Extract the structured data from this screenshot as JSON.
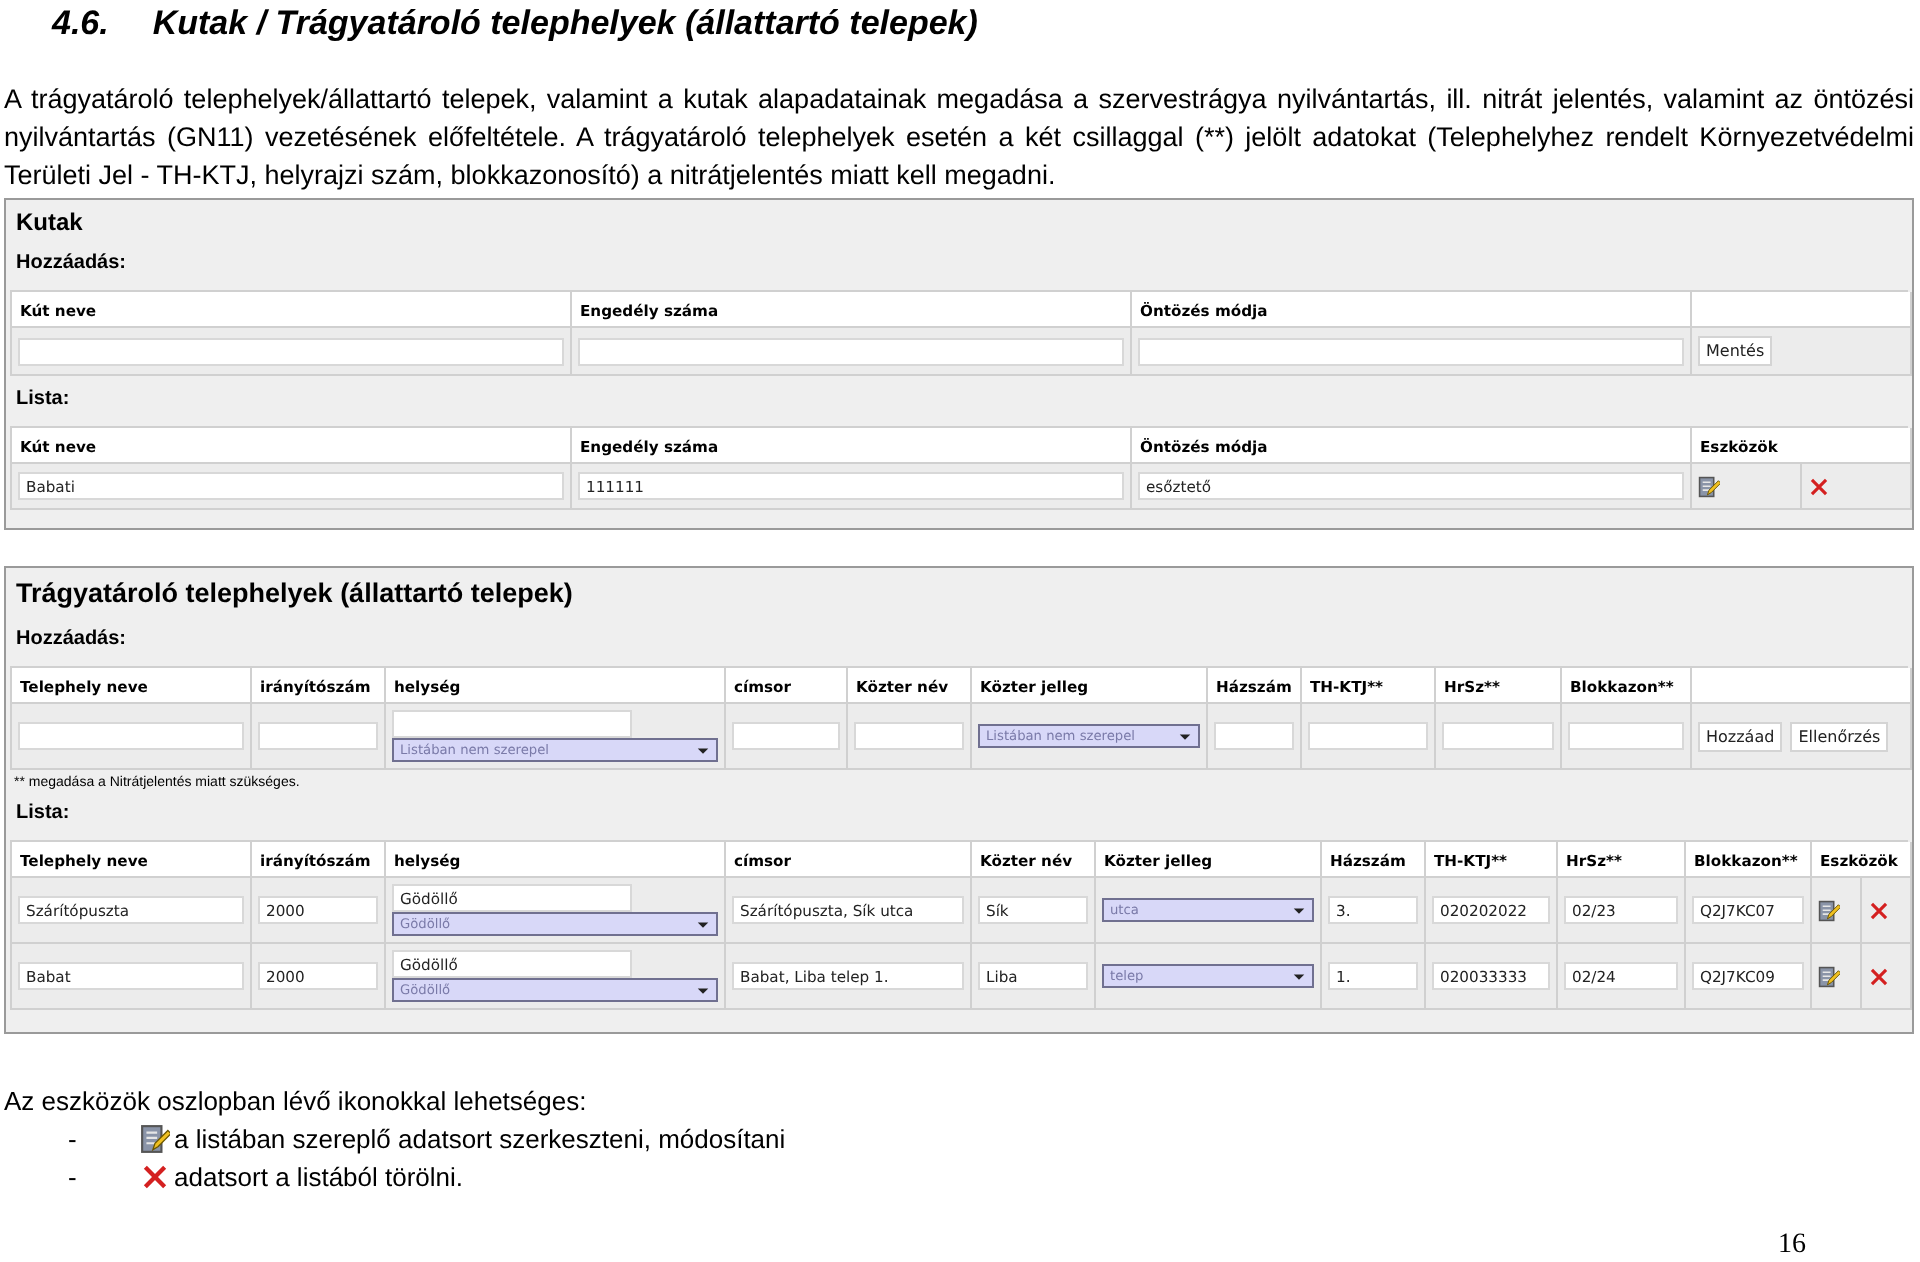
{
  "heading": {
    "number": "4.6.",
    "title": "Kutak / Trágyatároló telephelyek (állattartó telepek)"
  },
  "intro": "A trágyatároló telephelyek/állattartó telepek, valamint a kutak alapadatainak megadása a szervestrágya nyilvántartás, ill. nitrát jelentés, valamint az öntözési nyilvántartás (GN11) vezetésének előfeltétele. A trágyatároló telephelyek esetén a két csillaggal (**) jelölt adatokat (Telephelyhez rendelt Környezetvédelmi Területi Jel - TH-KTJ, helyrajzi szám, blokkazonosító) a nitrátjelentés miatt kell megadni.",
  "panels": [
    {
      "title": "Kutak",
      "add": {
        "title": "Hozzáadás:",
        "columns": [
          "Kút neve",
          "Engedély száma",
          "Öntözés módja"
        ],
        "fields": [
          {
            "kind": "input"
          },
          {
            "kind": "input"
          },
          {
            "kind": "input"
          }
        ],
        "buttons": [
          "Mentés"
        ]
      },
      "list": {
        "title": "Lista:",
        "columns": [
          "Kút neve",
          "Engedély száma",
          "Öntözés módja",
          "Eszközök"
        ],
        "rows": [
          {
            "cells": [
              {
                "kind": "input",
                "value": "Babati"
              },
              {
                "kind": "input",
                "value": "111111"
              },
              {
                "kind": "input",
                "value": "esőztető"
              }
            ]
          }
        ]
      }
    },
    {
      "title": "Trágyatároló telephelyek (állattartó telepek)",
      "add": {
        "title": "Hozzáadás:",
        "columns": [
          "Telephely neve",
          "irányítószám",
          "helység",
          "címsor",
          "Közter név",
          "Közter jelleg",
          "Házszám",
          "TH-KTJ**",
          "HrSz**",
          "Blokkazon**"
        ],
        "fields": [
          {
            "kind": "input"
          },
          {
            "kind": "input"
          },
          {
            "kind": "combo",
            "option": "Listában nem szerepel"
          },
          {
            "kind": "input"
          },
          {
            "kind": "input"
          },
          {
            "kind": "select",
            "option": "Listában nem szerepel"
          },
          {
            "kind": "input"
          },
          {
            "kind": "input"
          },
          {
            "kind": "input"
          },
          {
            "kind": "input"
          }
        ],
        "buttons": [
          "Hozzáad",
          "Ellenőrzés"
        ],
        "note": "** megadása a Nitrátjelentés miatt szükséges."
      },
      "list": {
        "title": "Lista:",
        "columns": [
          "Telephely neve",
          "irányítószám",
          "helység",
          "címsor",
          "Közter név",
          "Közter jelleg",
          "Házszám",
          "TH-KTJ**",
          "HrSz**",
          "Blokkazon**",
          "Eszközök"
        ],
        "rows": [
          {
            "cells": [
              {
                "kind": "input",
                "value": "Szárítópuszta"
              },
              {
                "kind": "input",
                "value": "2000"
              },
              {
                "kind": "combo",
                "value": "Gödöllő",
                "option": "Gödöllő"
              },
              {
                "kind": "input",
                "value": "Szárítópuszta, Sík utca"
              },
              {
                "kind": "input",
                "value": "Sík"
              },
              {
                "kind": "select",
                "option": "utca"
              },
              {
                "kind": "input",
                "value": "3."
              },
              {
                "kind": "input",
                "value": "020202022"
              },
              {
                "kind": "input",
                "value": "02/23"
              },
              {
                "kind": "input",
                "value": "Q2J7KC07"
              }
            ]
          },
          {
            "cells": [
              {
                "kind": "input",
                "value": "Babat"
              },
              {
                "kind": "input",
                "value": "2000"
              },
              {
                "kind": "combo",
                "value": "Gödöllő",
                "option": "Gödöllő"
              },
              {
                "kind": "input",
                "value": "Babat, Liba telep 1."
              },
              {
                "kind": "input",
                "value": "Liba"
              },
              {
                "kind": "select",
                "option": "telep"
              },
              {
                "kind": "input",
                "value": "1."
              },
              {
                "kind": "input",
                "value": "020033333"
              },
              {
                "kind": "input",
                "value": "02/24"
              },
              {
                "kind": "input",
                "value": "Q2J7KC09"
              }
            ]
          }
        ]
      }
    }
  ],
  "tools": {
    "intro": "Az eszközök oszlopban lévő ikonokkal lehetséges:",
    "items": [
      {
        "marker": "-",
        "kind": "edit",
        "text": "a listában szereplő adatsort szerkeszteni, módosítani"
      },
      {
        "marker": "-",
        "kind": "delete",
        "text": "adatsort a listából törölni."
      }
    ]
  },
  "page_number": "16"
}
